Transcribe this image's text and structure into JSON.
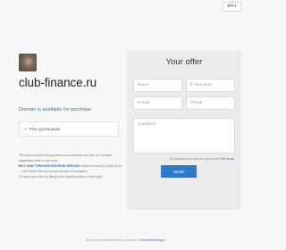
{
  "header": {
    "lang_selected": "en",
    "lang_chevron_icon": "chevron-down-icon"
  },
  "left": {
    "domain": "club-finance.ru",
    "available_text": "Domain is available for purchase",
    "price_bullet": "•",
    "price_text": "Price договорная",
    "note": {
      "line1": "The price includes the guarantor's commission and tax, the domain registration date is not reset.",
      "buy_now": "BUY NOW THROUGH ESCROW SERVICE",
      "line2": "which insures ALL DEALS for — the buyer's the purchased domain immediately.",
      "line3": "Or send your offer by filling in the feedback form on the right."
    }
  },
  "offer": {
    "title": "Your offer",
    "name_placeholder": "Name",
    "price_placeholder": "₽ Your price",
    "email_placeholder": "E-mail",
    "phone_placeholder": "Phone",
    "comment_placeholder": "Comment",
    "terms_prefix": "By submitting this form you agree to the",
    "terms_link": "Site Terms",
    "send_label": "SEND"
  },
  "footer": {
    "prefix": "This domain is parked free, courtesy of",
    "link": "DomainParking.ru"
  }
}
